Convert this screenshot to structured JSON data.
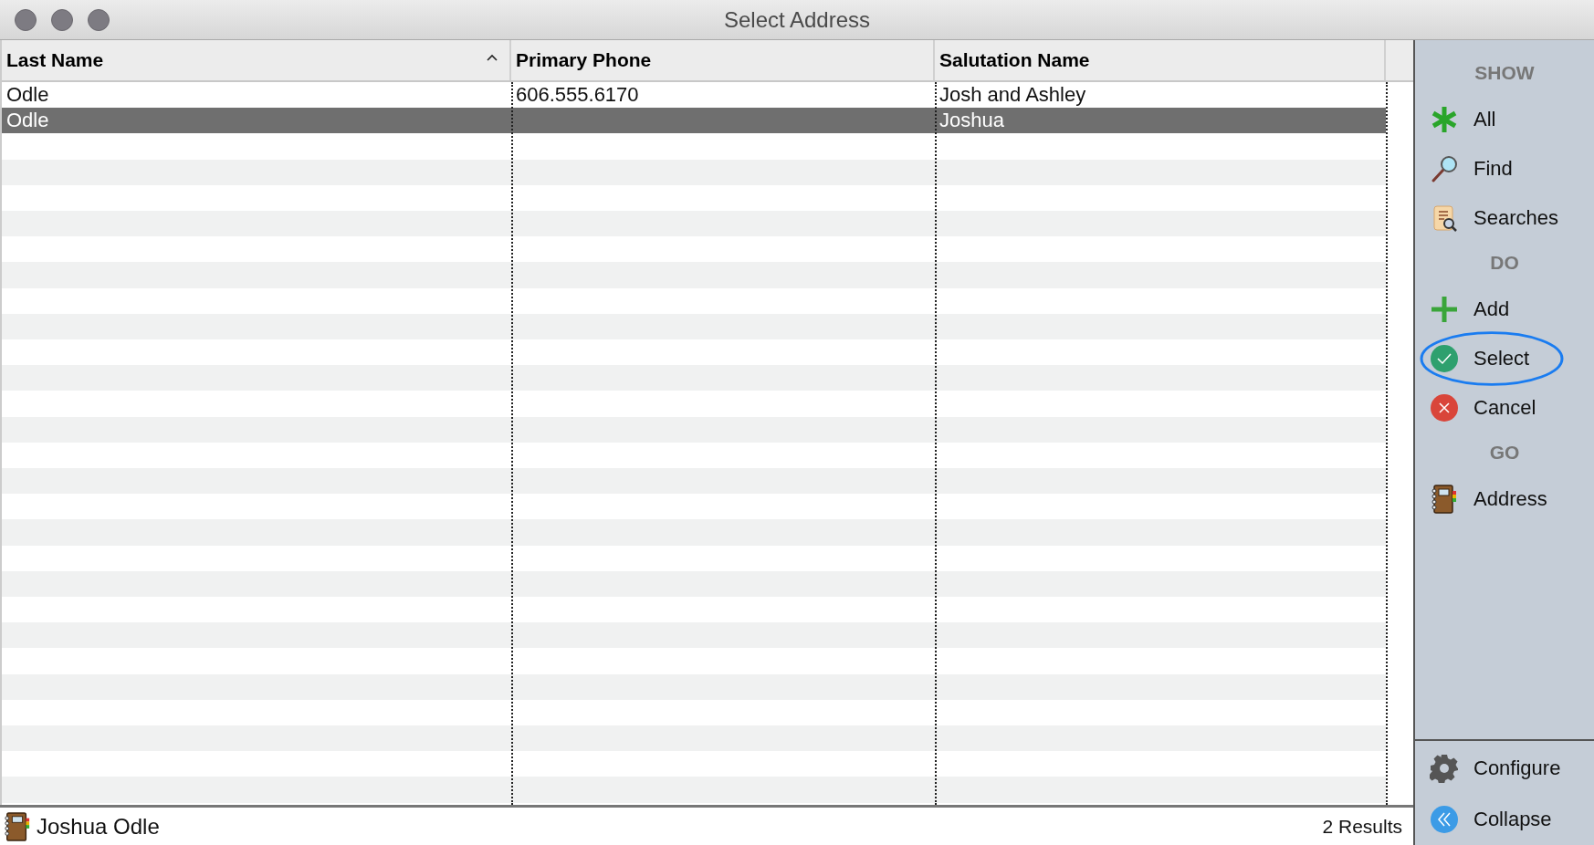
{
  "window": {
    "title": "Select Address"
  },
  "table": {
    "columns": [
      {
        "label": "Last Name",
        "sorted": true
      },
      {
        "label": "Primary Phone",
        "sorted": false
      },
      {
        "label": "Salutation Name",
        "sorted": false
      }
    ],
    "rows": [
      {
        "cells": [
          "Odle",
          "606.555.6170",
          "Josh and Ashley"
        ],
        "selected": false
      },
      {
        "cells": [
          "Odle",
          "",
          "Joshua"
        ],
        "selected": true
      }
    ]
  },
  "sidebar": {
    "sections": [
      {
        "heading": "SHOW",
        "items": [
          {
            "label": "All",
            "kind": "asterisk",
            "highlighted": false
          },
          {
            "label": "Find",
            "kind": "magnifier",
            "highlighted": false
          },
          {
            "label": "Searches",
            "kind": "scroll",
            "highlighted": false
          }
        ]
      },
      {
        "heading": "DO",
        "items": [
          {
            "label": "Add",
            "kind": "plus",
            "highlighted": false
          },
          {
            "label": "Select",
            "kind": "check",
            "highlighted": true
          },
          {
            "label": "Cancel",
            "kind": "cross",
            "highlighted": false
          }
        ]
      },
      {
        "heading": "GO",
        "items": [
          {
            "label": "Address",
            "kind": "notebook",
            "highlighted": false
          }
        ]
      }
    ],
    "footer": [
      {
        "label": "Configure",
        "kind": "gear"
      },
      {
        "label": "Collapse",
        "kind": "chevrons"
      }
    ]
  },
  "status_bar": {
    "record": "Joshua Odle",
    "count": "2 Results"
  }
}
